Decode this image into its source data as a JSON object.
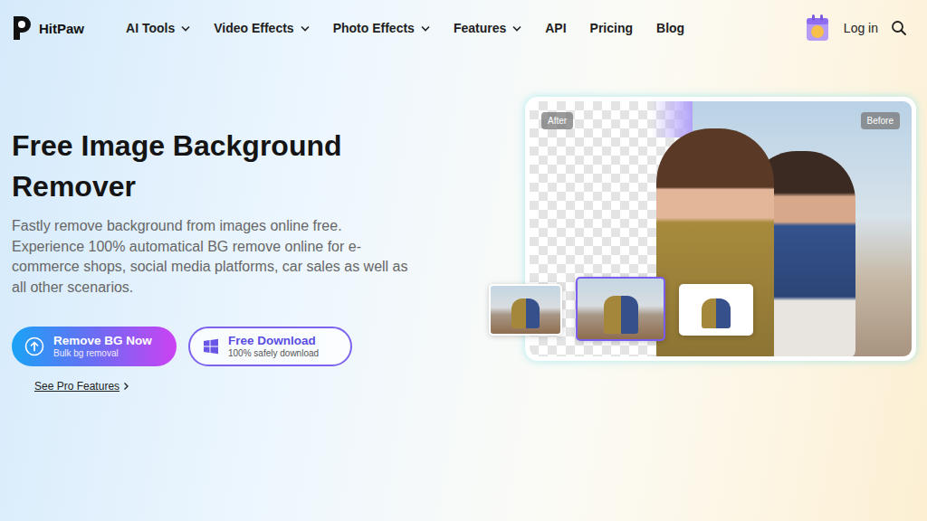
{
  "nav": {
    "logo": "HitPaw",
    "items": [
      {
        "label": "AI Tools",
        "dropdown": true
      },
      {
        "label": "Video Effects",
        "dropdown": true
      },
      {
        "label": "Photo Effects",
        "dropdown": true
      },
      {
        "label": "Features",
        "dropdown": true
      },
      {
        "label": "API",
        "dropdown": false
      },
      {
        "label": "Pricing",
        "dropdown": false
      },
      {
        "label": "Blog",
        "dropdown": false
      }
    ],
    "login": "Log in"
  },
  "hero": {
    "title": "Free Image Background Remover",
    "description": "Fastly remove background from images online free. Experience 100% automatical BG remove online for e-commerce shops, social media platforms, car sales as well as all other scenarios.",
    "primary_button": {
      "label": "Remove BG Now",
      "sublabel": "Bulk bg removal"
    },
    "secondary_button": {
      "label": "Free Download",
      "sublabel": "100% safely download"
    },
    "pro_link": "See Pro Features"
  },
  "preview": {
    "after_label": "After",
    "before_label": "Before",
    "thumbnails": [
      {
        "kind": "photo",
        "selected": false
      },
      {
        "kind": "photo",
        "selected": true
      },
      {
        "kind": "white",
        "selected": false
      }
    ]
  }
}
